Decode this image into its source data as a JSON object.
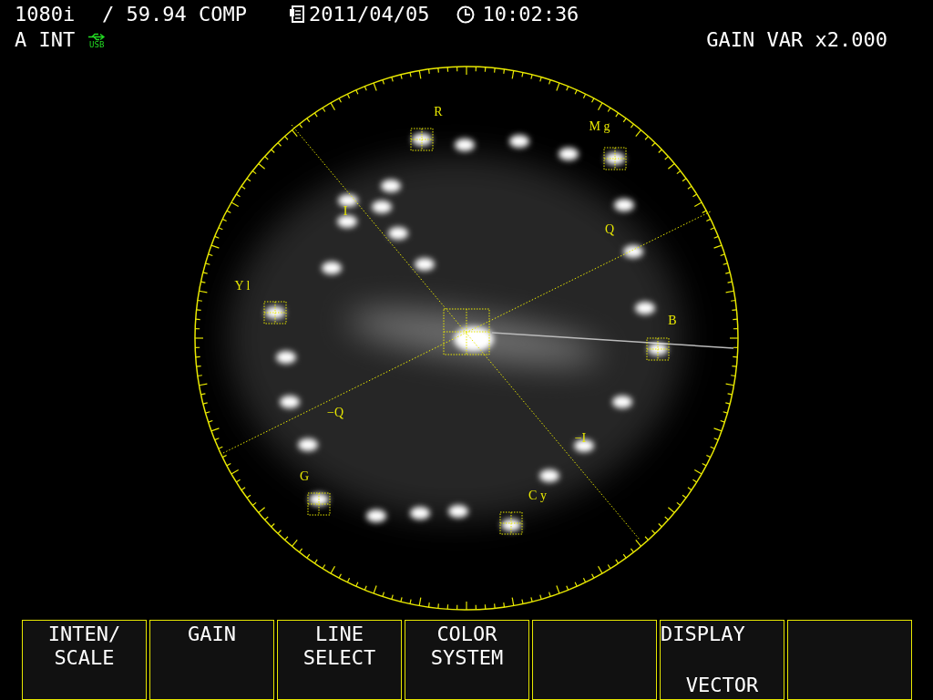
{
  "status": {
    "format": "1080i",
    "rate": "/ 59.94 COMP",
    "date": "2011/04/05",
    "time": "10:02:36",
    "input": "A INT",
    "usb": "USB",
    "gain": "GAIN VAR x2.000"
  },
  "graticule_labels": [
    {
      "kind": "R",
      "text": "R"
    },
    {
      "kind": "Mg",
      "text": "M g"
    },
    {
      "kind": "I",
      "text": "I"
    },
    {
      "kind": "Q",
      "text": "Q"
    },
    {
      "kind": "Yl",
      "text": "Y l"
    },
    {
      "kind": "B",
      "text": "B"
    },
    {
      "kind": "negQ",
      "text": "−Q"
    },
    {
      "kind": "negI",
      "text": "−I"
    },
    {
      "kind": "G",
      "text": "G"
    },
    {
      "kind": "Cy",
      "text": "C y"
    }
  ],
  "softkeys": [
    {
      "kind": "label",
      "lines": [
        "INTEN/",
        "SCALE"
      ]
    },
    {
      "kind": "label",
      "lines": [
        "GAIN"
      ]
    },
    {
      "kind": "label",
      "lines": [
        "LINE",
        "SELECT"
      ]
    },
    {
      "kind": "label",
      "lines": [
        "COLOR",
        "SYSTEM"
      ]
    },
    {
      "kind": "blank"
    },
    {
      "kind": "setting",
      "title": "DISPLAY",
      "value": "VECTOR"
    },
    {
      "kind": "blank"
    }
  ]
}
